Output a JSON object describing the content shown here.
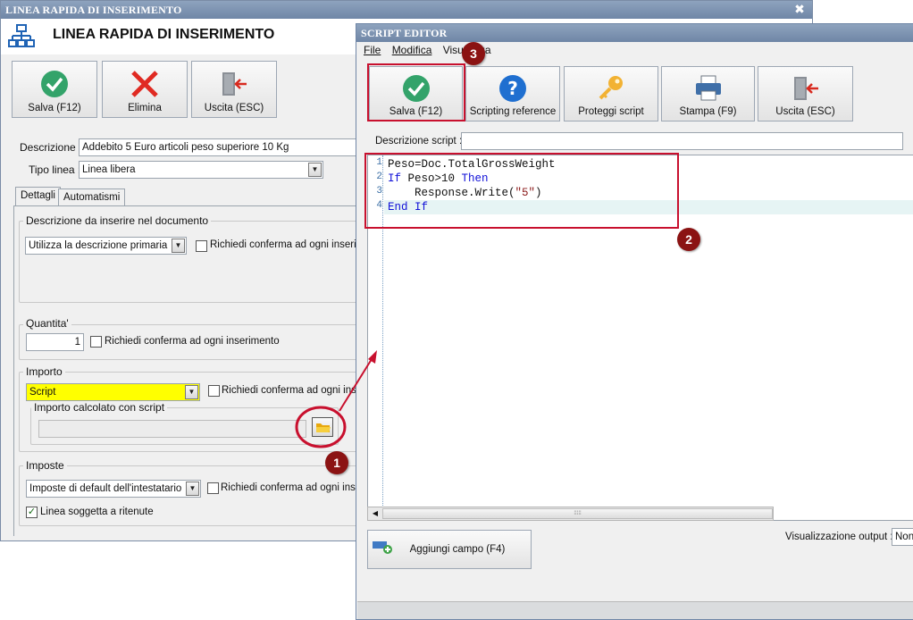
{
  "main_window": {
    "title": "LINEA RAPIDA DI INSERIMENTO",
    "close_glyph": "✖",
    "app_title": "LINEA RAPIDA DI INSERIMENTO",
    "toolbar": {
      "save_label": "Salva (F12)",
      "delete_label": "Elimina",
      "exit_label": "Uscita (ESC)"
    },
    "form": {
      "description_label": "Descrizione :",
      "description_value": "Addebito 5 Euro articoli peso superiore 10 Kg",
      "line_type_label": "Tipo linea :",
      "line_type_value": "Linea libera"
    },
    "tabs": [
      "Dettagli",
      "Automatismi"
    ],
    "groups": {
      "descrizione": {
        "title": "Descrizione da inserire nel documento",
        "select_value": "Utilizza la descrizione primaria",
        "confirm_label": "Richiedi conferma ad ogni inserimento"
      },
      "quantita": {
        "title": "Quantita'",
        "value": "1",
        "confirm_label": "Richiedi conferma ad ogni inserimento"
      },
      "importo": {
        "title": "Importo",
        "select_value": "Script",
        "confirm_label": "Richiedi conferma ad ogni inserimento",
        "script_subgroup_title": "Importo calcolato con script"
      },
      "imposte": {
        "title": "Imposte",
        "select_value": "Imposte di default dell'intestatario",
        "confirm_label": "Richiedi conferma ad ogni inserimento",
        "withholding_label": "Linea soggetta a ritenute",
        "withholding_checked": true
      }
    }
  },
  "script_editor": {
    "title": "SCRIPT EDITOR",
    "menu": [
      "File",
      "Modifica",
      "Visualizza"
    ],
    "toolbar": {
      "save_label": "Salva (F12)",
      "reference_label": "Scripting reference",
      "protect_label": "Proteggi script",
      "print_label": "Stampa (F9)",
      "exit_label": "Uscita (ESC)"
    },
    "script_description_label": "Descrizione script :",
    "script_description_value": "",
    "code_lines": [
      {
        "num": "1"
      },
      {
        "num": "2"
      },
      {
        "num": "3"
      },
      {
        "num": "4"
      }
    ],
    "code_tokens": {
      "l1": "Peso=Doc.TotalGrossWeight",
      "l2_kw1": "If",
      "l2_mid": " Peso>10 ",
      "l2_kw2": "Then",
      "l3_a": "    Response.Write(",
      "l3_str": "\"5\"",
      "l3_b": ")",
      "l4_kw": "End If"
    },
    "add_field_label": "Aggiungi campo (F4)",
    "output_label": "Visualizzazione output :",
    "output_value": "Non"
  },
  "annotations": {
    "badge1": "1",
    "badge2": "2",
    "badge3": "3",
    "accent_color": "#c8102e",
    "badge_color": "#8b1313"
  }
}
